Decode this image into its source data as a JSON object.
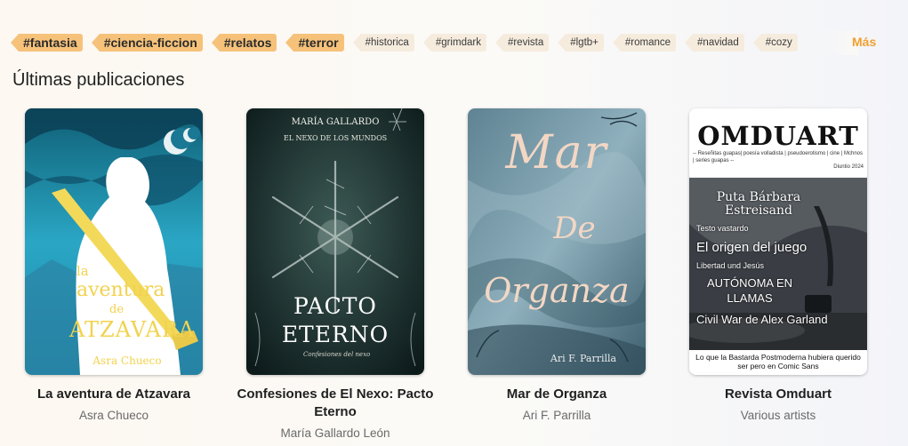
{
  "tags": {
    "main": [
      "#fantasia",
      "#ciencia-ficcion",
      "#relatos",
      "#terror"
    ],
    "secondary": [
      "#historica",
      "#grimdark",
      "#revista",
      "#lgtb+",
      "#romance",
      "#navidad",
      "#cozy"
    ],
    "more_label": "Más",
    "colors": {
      "main": "#f6c27a",
      "secondary": "#f6ecde",
      "more": "#f0a030"
    }
  },
  "section_title": "Últimas publicaciones",
  "books": [
    {
      "title": "La aventura de Atzavara",
      "author": "Asra Chueco",
      "cover": {
        "line1": "la",
        "line2": "aventura",
        "line3": "de",
        "line4": "ATZAVARA",
        "author": "Asra Chueco"
      }
    },
    {
      "title": "Confesiones de El Nexo: Pacto Eterno",
      "author": "María Gallardo León",
      "cover": {
        "author": "MARÍA GALLARDO",
        "series": "EL NEXO DE LOS MUNDOS",
        "title1": "PACTO",
        "title2": "ETERNO",
        "subtitle": "Confesiones del nexo"
      }
    },
    {
      "title": "Mar de Organza",
      "author": "Ari F. Parrilla",
      "cover": {
        "w1": "Mar",
        "w2": "De",
        "w3": "Organza",
        "author": "Ari F. Parrilla"
      }
    },
    {
      "title": "Revista Omduart",
      "author": "Various artists",
      "cover": {
        "masthead": "OMDUART",
        "tagline": "-- Reseñitas guapas| poesía volladista | pseudoerotismo | cine | Mchnos | series guapas --",
        "issue": "Diuntio 2024",
        "items": [
          "Puta Bárbara Estreisand",
          "Testo vastardo",
          "El origen del juego",
          "Libertad und Jesús",
          "AUTÓNOMA EN LLAMAS",
          "Civil War de Alex Garland"
        ],
        "footer": "Lo que la Bastarda Postmoderna hubiera querido ser pero en Comic Sans"
      }
    }
  ]
}
